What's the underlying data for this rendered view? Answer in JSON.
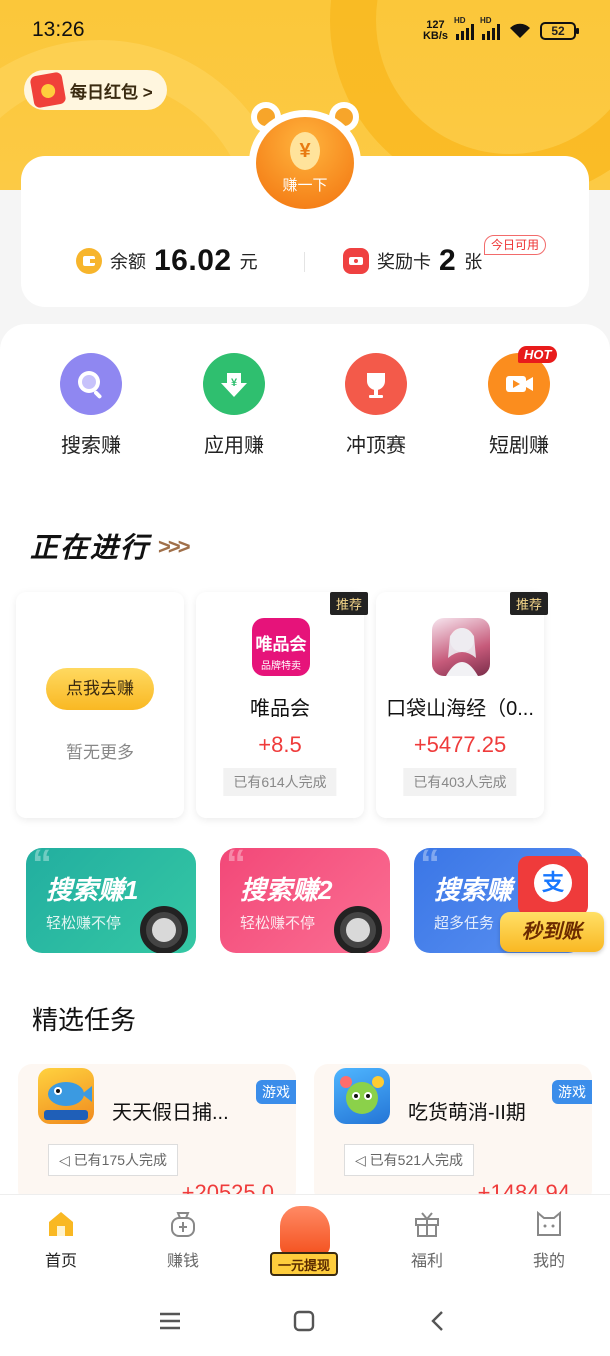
{
  "status": {
    "time": "13:26",
    "speed_value": "127",
    "speed_unit": "KB/s",
    "signal1": "HD",
    "signal2": "HD",
    "battery": "52"
  },
  "daily": {
    "label": "每日红包 >"
  },
  "earn": {
    "yen": "¥",
    "label": "赚一下"
  },
  "balance": {
    "label": "余额",
    "amount": "16.02",
    "unit": "元"
  },
  "reward_card": {
    "label": "奖励卡",
    "count": "2",
    "unit": "张",
    "badge": "今日可用"
  },
  "quick_actions": [
    {
      "label": "搜索赚",
      "color": "#8f87f1"
    },
    {
      "label": "应用赚",
      "color": "#2fbf6f"
    },
    {
      "label": "冲顶赛",
      "color": "#f35a4a"
    },
    {
      "label": "短剧赚",
      "color": "#fb8d1e"
    }
  ],
  "hot_tag": "HOT",
  "ongoing": {
    "title": "正在进行",
    "arrows": ">>>",
    "placeholder": {
      "button": "点我去赚",
      "text": "暂无更多"
    },
    "tasks": [
      {
        "badge": "推荐",
        "logo_text": "唯品会",
        "logo_sub": "品牌特卖",
        "name": "唯品会",
        "reward": "+8.5",
        "done": "已有614人完成"
      },
      {
        "badge": "推荐",
        "name": "口袋山海经（0...",
        "reward": "+5477.25",
        "done": "已有403人完成"
      }
    ]
  },
  "search_cards": [
    {
      "title": "搜索赚1",
      "sub": "轻松赚不停",
      "color_a": "#27b3a3",
      "color_b": "#2fc7a0"
    },
    {
      "title": "搜索赚2",
      "sub": "轻松赚不停",
      "color_a": "#f4527f",
      "color_b": "#f96b8e"
    },
    {
      "title": "搜索赚",
      "sub": "超多任务",
      "color_a": "#3f7de8",
      "color_b": "#5a8ff0"
    }
  ],
  "promo": {
    "alipay": "支",
    "label": "秒到账"
  },
  "featured": {
    "title": "精选任务",
    "items": [
      {
        "tag": "游戏",
        "name": "天天假日捕...",
        "done": "已有175人完成",
        "reward": "+20525.0"
      },
      {
        "tag": "游戏",
        "name": "吃货萌消-II期",
        "done": "已有521人完成",
        "reward": "+1484.94"
      }
    ]
  },
  "tabs": [
    {
      "label": "首页"
    },
    {
      "label": "赚钱"
    },
    {
      "label": "一元提现"
    },
    {
      "label": "福利"
    },
    {
      "label": "我的"
    }
  ]
}
